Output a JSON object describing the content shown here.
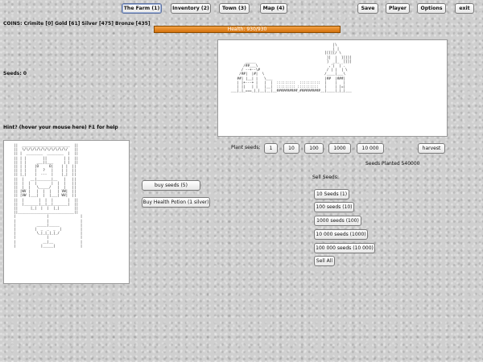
{
  "tabs": [
    {
      "label": "The Farm (1)"
    },
    {
      "label": "Inventory (2)"
    },
    {
      "label": "Town (3)"
    },
    {
      "label": "Map (4)"
    }
  ],
  "top_right": {
    "save": "Save",
    "player": "Player",
    "options": "Options",
    "exit": "exit"
  },
  "coins": "COINS: Crimite [0]  Gold [61]  Silver [475]  Bronze [435]",
  "health": {
    "text": "Health: 930/930",
    "fraction": 1.0
  },
  "seeds_label": "Seeds: 0",
  "hint": "Hint? (hover your mouse here) F1 for help",
  "plant": {
    "label": "Plant seeds:",
    "options": [
      "1",
      "10",
      "100",
      "1000",
      "10 000"
    ],
    "harvest": "harvest"
  },
  "seeds_planted": "Seeds Planted 540000",
  "sell": {
    "label": "Sell Seeds:",
    "options": [
      "10 Seeds (1)",
      "100 seeds (10)",
      "1000 seeds (100)",
      "10 000 seeds (1000)",
      "100 000 seeds (10 000)"
    ],
    "sell_all": "Sell All"
  },
  "shop": {
    "buy_seeds": "buy seeds (5)",
    "buy_potion": "Buy Health Potion (1 silver)"
  },
  "farm_art": "                                                    |\\\n                                                    | |\n                                                [[[[[/ \\\n                                                 ]]  |  ]]]]]\n          _____                                  ]  _[_  ]]]]\n         /##___\\                                  ,'|  |`.\n        / --+--\\#                                / | |  | \\\n       /##|  |#|  \\                             /____|___\\\n      ##| |__| |   \\___                         |##  |###|\n      | |+---+ |   |  |  :::::::::  ::::::::::  |    |   |\n      | ||   | |   |__|  ::::::::: ::::::::::   |    | |=|\n   ___|_|_===_|_|__|__|__##########_##########__|____|_|_|___",
  "character_art": "||  _______________________  ||\n||  \\/\\/\\/\\/\\/\\/\\/\\/\\/\\/\\/   ||\n|| |  ________  ________  |  ||\n|| | |        ||        | |  ||\n|| | |     ___||___     | |  ||\n|| | |    |O     O|    | |  ||\n|| | |    |   ?   |    | |  ||\n|| |_|    |  ---  |    |_|  ||\n||  |   __|_______|__   |   ||\n||  |  |  |       |  |  |   ||\n||  |  |   \\_____/   |  |   ||\n|| |WV |   |  |  |   | VW|  ||\n|| |VW |___|  |  |___| WV|  ||\n||  |       |  |  |       |  ||\n||  |_______|__|__|_______|  ||\n||      |_|  |  |  |_|       ||\n||___________________________||\n|               |               |\n|               |               |\n|          _____|_____          |\n|         |  _  _  _  |         |\n|          \\_|_|_|_|_/          |\n|               |               |\n|             __|__             |\n|            |_____|            |"
}
